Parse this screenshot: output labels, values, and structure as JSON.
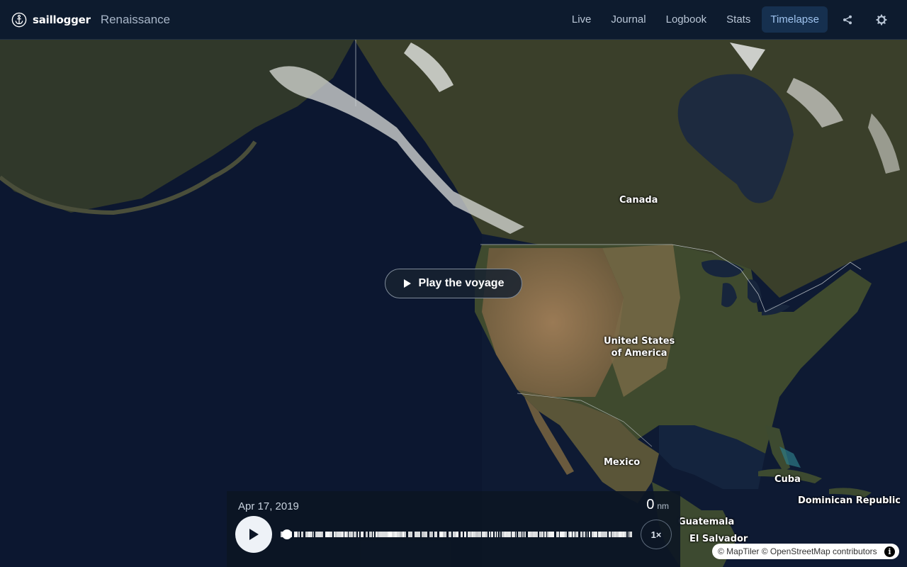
{
  "header": {
    "brand": "saillogger",
    "vessel": "Renaissance",
    "nav": [
      {
        "label": "Live",
        "active": false
      },
      {
        "label": "Journal",
        "active": false
      },
      {
        "label": "Logbook",
        "active": false
      },
      {
        "label": "Stats",
        "active": false
      },
      {
        "label": "Timelapse",
        "active": true
      }
    ],
    "icons": [
      "share-icon",
      "gear-icon"
    ]
  },
  "map": {
    "labels": {
      "canada": "Canada",
      "usa_line1": "United States",
      "usa_line2": "of America",
      "mexico": "Mexico",
      "cuba": "Cuba",
      "dominican_republic": "Dominican Republic",
      "guatemala": "Guatemala",
      "el_salvador": "El Salvador"
    },
    "attribution": "© MapTiler © OpenStreetMap contributors"
  },
  "overlay": {
    "play_voyage_label": "Play the voyage"
  },
  "timeline": {
    "date": "Apr 17, 2019",
    "distance_value": "0",
    "distance_unit": "nm",
    "speed_label": "1×",
    "progress": 0
  },
  "colors": {
    "header_bg": "#0d1b2e",
    "active_tab_bg": "#16304f",
    "active_tab_text": "#9fc3ee",
    "ocean": "#0e1a33"
  }
}
